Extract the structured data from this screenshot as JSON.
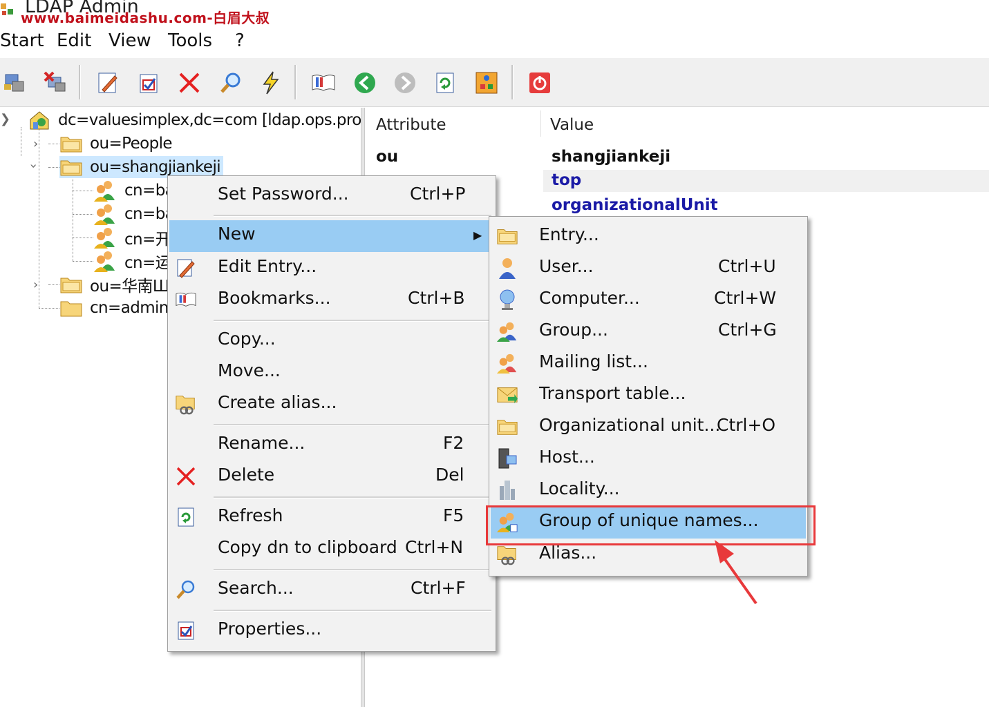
{
  "window": {
    "title": "LDAP Admin",
    "watermark": "www.baimeidashu.com-白眉大叔"
  },
  "menubar": {
    "items": [
      "Start",
      "Edit",
      "View",
      "Tools",
      "?"
    ]
  },
  "toolbar": {
    "buttons": [
      "connect-icon",
      "disconnect-icon",
      "edit-icon",
      "properties-icon",
      "delete-icon",
      "search-icon",
      "lightning-icon",
      "bookmarks-icon",
      "back-arrow-icon",
      "forward-arrow-icon",
      "refresh-icon",
      "schema-icon",
      "exit-icon"
    ]
  },
  "tree": {
    "root": "dc=valuesimplex,dc=com [ldap.ops.prod.v",
    "nodes": [
      {
        "label": "ou=People"
      },
      {
        "label": "ou=shangjiankeji"
      },
      {
        "label": "cn=ba"
      },
      {
        "label": "cn=ba"
      },
      {
        "label": "cn=开"
      },
      {
        "label": "cn=运"
      },
      {
        "label": "ou=华南Ш"
      },
      {
        "label": "cn=admin"
      }
    ]
  },
  "attributes": {
    "header_attribute": "Attribute",
    "header_value": "Value",
    "rows": [
      {
        "attribute": "ou",
        "value": "shangjiankeji",
        "color": "#111111"
      },
      {
        "attribute": "",
        "value": "top",
        "color": "#1a1aa6"
      },
      {
        "attribute": "",
        "value": "organizationalUnit",
        "color": "#1a1aa6"
      }
    ]
  },
  "context_menu": {
    "items": [
      {
        "label": "Set Password...",
        "shortcut": "Ctrl+P"
      },
      {
        "label": "New",
        "shortcut": ""
      },
      {
        "label": "Edit Entry...",
        "shortcut": ""
      },
      {
        "label": "Bookmarks...",
        "shortcut": "Ctrl+B"
      },
      {
        "label": "Copy...",
        "shortcut": ""
      },
      {
        "label": "Move...",
        "shortcut": ""
      },
      {
        "label": "Create alias...",
        "shortcut": ""
      },
      {
        "label": "Rename...",
        "shortcut": "F2"
      },
      {
        "label": "Delete",
        "shortcut": "Del"
      },
      {
        "label": "Refresh",
        "shortcut": "F5"
      },
      {
        "label": "Copy dn to clipboard",
        "shortcut": "Ctrl+N"
      },
      {
        "label": "Search...",
        "shortcut": "Ctrl+F"
      },
      {
        "label": "Properties...",
        "shortcut": ""
      }
    ]
  },
  "submenu_new": {
    "items": [
      {
        "label": "Entry...",
        "shortcut": ""
      },
      {
        "label": "User...",
        "shortcut": "Ctrl+U"
      },
      {
        "label": "Computer...",
        "shortcut": "Ctrl+W"
      },
      {
        "label": "Group...",
        "shortcut": "Ctrl+G"
      },
      {
        "label": "Mailing list...",
        "shortcut": ""
      },
      {
        "label": "Transport table...",
        "shortcut": ""
      },
      {
        "label": "Organizational unit...",
        "shortcut": "Ctrl+O"
      },
      {
        "label": "Host...",
        "shortcut": ""
      },
      {
        "label": "Locality...",
        "shortcut": ""
      },
      {
        "label": "Group of unique names...",
        "shortcut": ""
      },
      {
        "label": "Alias...",
        "shortcut": ""
      }
    ]
  },
  "colors": {
    "highlight": "#99ccf3",
    "annotation_red": "#e8393b",
    "watermark": "#c0101b"
  }
}
